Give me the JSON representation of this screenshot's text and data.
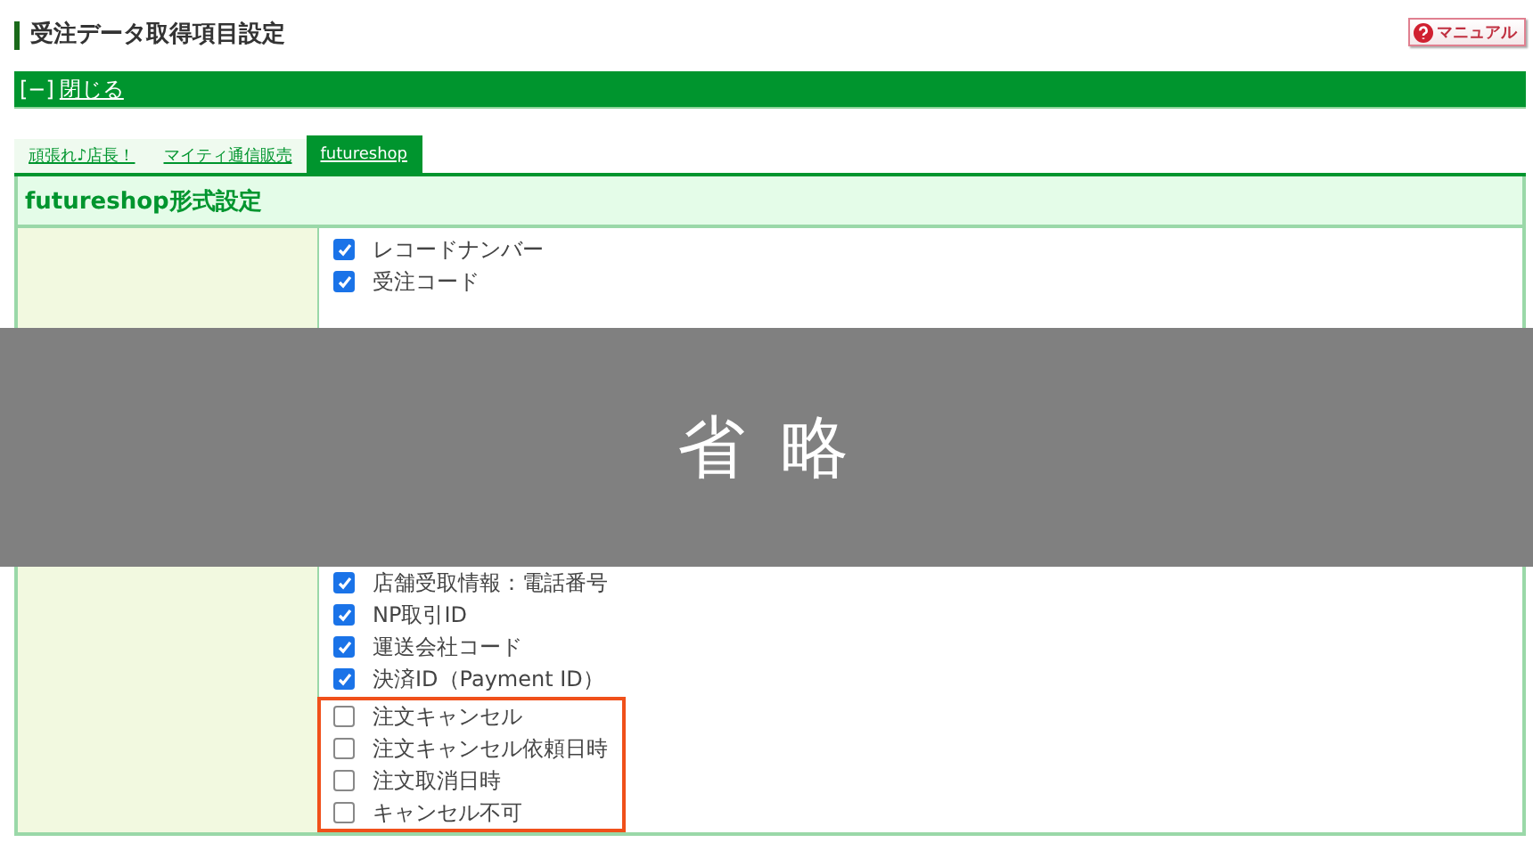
{
  "page_title": "受注データ取得項目設定",
  "manual_button": "マニュアル",
  "collapse_bar": {
    "bracket": "[−]",
    "link": "閉じる"
  },
  "tabs": [
    {
      "label": "頑張れ♪店長！",
      "selected": false
    },
    {
      "label": "マイティ通信販売",
      "selected": false
    },
    {
      "label": "futureshop",
      "selected": true
    }
  ],
  "section_title": "futureshop形式設定",
  "options_top": [
    {
      "label": "レコードナンバー",
      "checked": true
    },
    {
      "label": "受注コード",
      "checked": true
    }
  ],
  "options_bottom": [
    {
      "label": "店舗受取情報：電話番号",
      "checked": true
    },
    {
      "label": "NP取引ID",
      "checked": true
    },
    {
      "label": "運送会社コード",
      "checked": true
    },
    {
      "label": "決済ID（Payment ID）",
      "checked": true
    }
  ],
  "highlighted_options": [
    {
      "label": "注文キャンセル",
      "checked": false
    },
    {
      "label": "注文キャンセル依頼日時",
      "checked": false
    },
    {
      "label": "注文取消日時",
      "checked": false
    },
    {
      "label": "キャンセル不可",
      "checked": false
    }
  ],
  "omission_banner": "省 略"
}
